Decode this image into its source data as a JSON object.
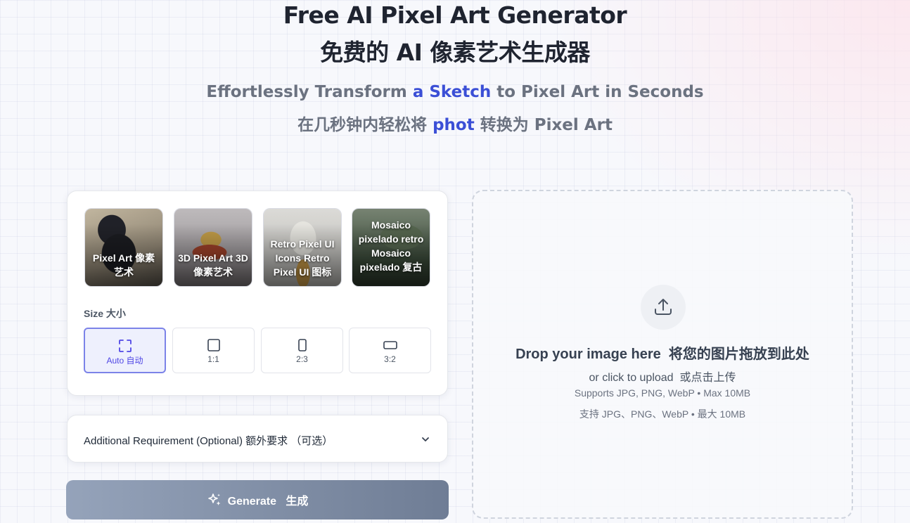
{
  "hero": {
    "title_en": "Free AI Pixel Art Generator",
    "title_zh": "免费的 AI 像素艺术生成器",
    "subtitle_en_before": "Effortlessly Transform ",
    "subtitle_en_highlight": "a Sketch",
    "subtitle_en_after": " to Pixel Art in Seconds",
    "subtitle_zh_before": "在几秒钟内轻松将 ",
    "subtitle_zh_highlight": "phot",
    "subtitle_zh_after": " 转换为 Pixel Art"
  },
  "styles": [
    {
      "label": "Pixel Art 像素艺术",
      "icon": "cat-pixel-art-thumbnail"
    },
    {
      "label": "3D Pixel Art 3D 像素艺术",
      "icon": "ship-3d-pixel-thumbnail"
    },
    {
      "label": "Retro Pixel UI Icons Retro Pixel UI 图标",
      "icon": "ice-cream-pixel-thumbnail"
    },
    {
      "label": "Mosaico pixelado retro Mosaico pixelado 复古",
      "icon": "mosaic-pixel-thumbnail"
    }
  ],
  "size": {
    "label": "Size 大小",
    "options": [
      {
        "label": "Auto 自动",
        "icon": "auto-frame-icon",
        "selected": true
      },
      {
        "label": "1:1",
        "icon": "square-icon",
        "selected": false
      },
      {
        "label": "2:3",
        "icon": "portrait-icon",
        "selected": false
      },
      {
        "label": "3:2",
        "icon": "landscape-icon",
        "selected": false
      }
    ]
  },
  "additional": {
    "label": "Additional Requirement (Optional)   额外要求 （可选）",
    "icon": "chevron-down-icon"
  },
  "generate": {
    "label": "Generate   生成",
    "icon": "sparkles-icon"
  },
  "dropzone": {
    "title": "Drop your image here  将您的图片拖放到此处",
    "subtitle": "or click to upload  或点击上传",
    "note_en": "Supports JPG, PNG, WebP • Max 10MB",
    "note_zh": "支持 JPG、PNG、WebP • 最大 10MB",
    "icon": "upload-icon"
  },
  "colors": {
    "accent": "#4f46e5",
    "highlight": "#3b4fd6",
    "button_start": "#95a3ba",
    "button_end": "#6f7d95"
  }
}
